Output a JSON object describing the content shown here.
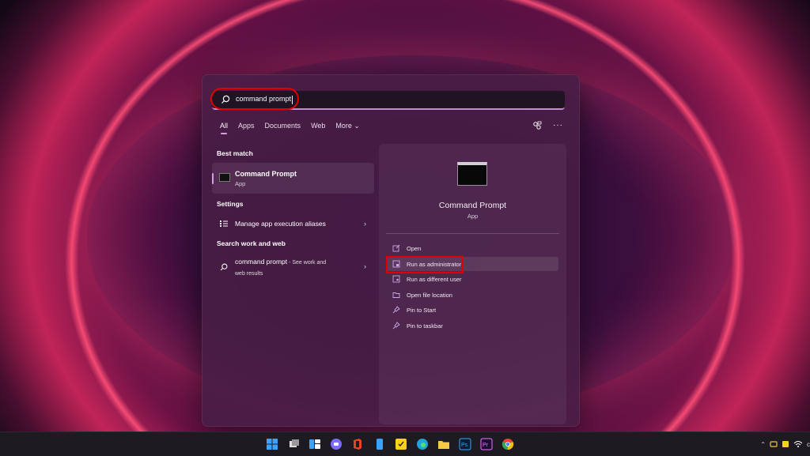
{
  "search": {
    "query": "command prompt"
  },
  "tabs": [
    {
      "label": "All"
    },
    {
      "label": "Apps"
    },
    {
      "label": "Documents"
    },
    {
      "label": "Web"
    },
    {
      "label": "More ⌄"
    }
  ],
  "left": {
    "best_match_heading": "Best match",
    "best_match": {
      "title": "Command Prompt",
      "subtitle": "App"
    },
    "settings_heading": "Settings",
    "settings_item": "Manage app execution aliases",
    "web_heading": "Search work and web",
    "web_item": {
      "query": "command prompt",
      "suffix": " - See work and",
      "line2": "web results"
    }
  },
  "right": {
    "title": "Command Prompt",
    "subtitle": "App",
    "actions": [
      {
        "label": "Open",
        "icon": "open-external-icon"
      },
      {
        "label": "Run as administrator",
        "icon": "shield-admin-icon"
      },
      {
        "label": "Run as different user",
        "icon": "user-switch-icon"
      },
      {
        "label": "Open file location",
        "icon": "folder-icon"
      },
      {
        "label": "Pin to Start",
        "icon": "pin-icon"
      },
      {
        "label": "Pin to taskbar",
        "icon": "pin-icon"
      }
    ]
  },
  "taskbar": {
    "apps": [
      "windows-start-icon",
      "task-view-icon",
      "widgets-icon",
      "teams-chat-icon",
      "office-icon",
      "phone-link-icon",
      "sticky-notes-icon",
      "edge-icon",
      "file-explorer-icon",
      "photoshop-icon",
      "premiere-icon",
      "chrome-icon"
    ],
    "tray_text": "c"
  },
  "colors": {
    "accent": "#d3a0e0",
    "highlight_box": "#e00000",
    "panel": "#48204a"
  }
}
